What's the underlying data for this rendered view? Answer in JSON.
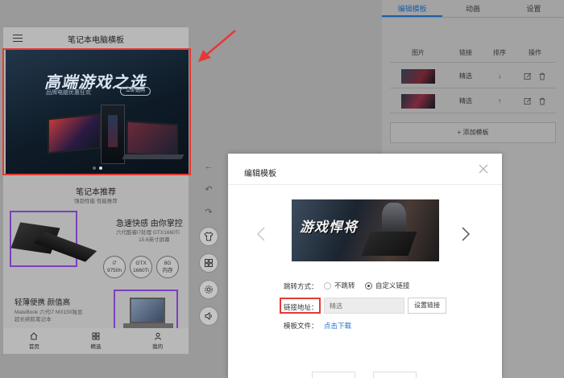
{
  "phone": {
    "title": "笔记本电脑横板",
    "banner": {
      "headline": "高端游戏之选",
      "sub": "品牌电脑优惠狂欢",
      "pill": "立即选购"
    },
    "section": {
      "title": "笔记本推荐",
      "subtitle": "强劲性能 性能推荐"
    },
    "product1": {
      "title": "急速快感 由你掌控",
      "spec1": "六代酷睿i7处理 GTX1660Ti",
      "spec2": "15.6英寸屏幕",
      "badges": [
        {
          "top": "i7",
          "bottom": "9750h"
        },
        {
          "top": "GTX",
          "bottom": "1660Ti"
        },
        {
          "top": "8G",
          "bottom": "内存"
        }
      ]
    },
    "product2": {
      "title": "轻薄便携 颜值高",
      "spec1": "MateBook 六代i7 MX150独显",
      "spec2": "超长续航笔记本"
    },
    "tabs": {
      "home": "首页",
      "picks": "精选",
      "mine": "我的"
    }
  },
  "panel": {
    "tabs": [
      "编辑模板",
      "动画",
      "设置"
    ],
    "table": {
      "headers": {
        "image": "图片",
        "link": "链接",
        "sort": "排序",
        "ops": "操作"
      },
      "rows": [
        {
          "link": "精选",
          "sort": "↓"
        },
        {
          "link": "精选",
          "sort": "↑"
        }
      ]
    },
    "add_label": "+ 添加模板"
  },
  "modal": {
    "title": "编辑模板",
    "image_text": "游戏悍将",
    "jump_label": "跳转方式：",
    "radio_none": "不跳转",
    "radio_custom": "自定义链接",
    "link_label": "链接地址：",
    "link_placeholder": "精选",
    "set_link": "设置链接",
    "file_label": "模板文件：",
    "download": "点击下载"
  },
  "colors": {
    "accent": "#1d5fa8",
    "highlight": "#e53935",
    "frame": "#7b3fbf",
    "link": "#1d6fd1"
  }
}
